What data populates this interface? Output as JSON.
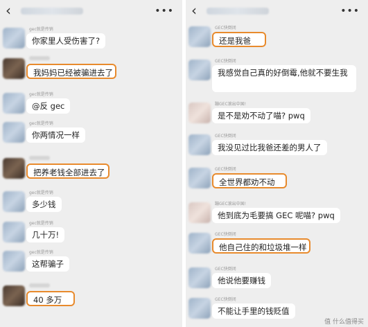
{
  "left": {
    "back_icon": "chevron-left-icon",
    "more_icon": "more-icon",
    "messages": [
      {
        "sender": "gec就是传销",
        "text": "你家里人受伤害了?",
        "avatar": "blue",
        "highlight": false
      },
      {
        "sender": "",
        "text": "我妈妈已经被骗进去了",
        "avatar": "dark",
        "highlight": true
      },
      {
        "sender": "gec就是传销",
        "text": "@反 gec",
        "avatar": "blue",
        "highlight": false
      },
      {
        "sender": "gec就是传销",
        "text": "你两情况一样",
        "avatar": "blue",
        "highlight": false
      },
      {
        "sender": "",
        "text": "把养老钱全部进去了",
        "avatar": "dark",
        "highlight": true
      },
      {
        "sender": "gec就是传销",
        "text": "多少钱",
        "avatar": "blue",
        "highlight": false
      },
      {
        "sender": "gec就是传销",
        "text": "几十万!",
        "avatar": "blue",
        "highlight": false
      },
      {
        "sender": "gec就是传销",
        "text": "这帮骗子",
        "avatar": "blue",
        "highlight": false
      },
      {
        "sender": "",
        "text": "40 多万",
        "avatar": "dark",
        "highlight": true
      }
    ]
  },
  "right": {
    "back_icon": "chevron-left-icon",
    "more_icon": "more-icon",
    "messages": [
      {
        "sender": "GEC快倒闭",
        "text": "还是我爸",
        "avatar": "blue",
        "highlight": true
      },
      {
        "sender": "GEC快倒闭",
        "text": "我感觉自己真的好倒霉,他就不要生我",
        "avatar": "blue",
        "highlight": false
      },
      {
        "sender": "蹦GEC滚出中国!",
        "text": "是不是劝不动了喵? pwq",
        "avatar": "pink",
        "highlight": false
      },
      {
        "sender": "GEC快倒闭",
        "text": "我没见过比我爸还差的男人了",
        "avatar": "blue",
        "highlight": false
      },
      {
        "sender": "GEC快倒闭",
        "text": "全世界都劝不动",
        "avatar": "blue",
        "highlight": true
      },
      {
        "sender": "蹦GEC滚出中国!",
        "text": "他到底为毛要搞 GEC 呢喵? pwq",
        "avatar": "pink",
        "highlight": false
      },
      {
        "sender": "GEC快倒闭",
        "text": "他自己住的和垃圾堆一样",
        "avatar": "blue",
        "highlight": true
      },
      {
        "sender": "GEC快倒闭",
        "text": "他说他要赚钱",
        "avatar": "blue",
        "highlight": false
      },
      {
        "sender": "GEC快倒闭",
        "text": "不能让手里的钱贬值",
        "avatar": "blue",
        "highlight": false
      }
    ]
  },
  "colors": {
    "highlight": "#e88a2c",
    "bubble": "#ffffff",
    "background": "#eeeeee"
  },
  "watermark": "值 什么值得买"
}
